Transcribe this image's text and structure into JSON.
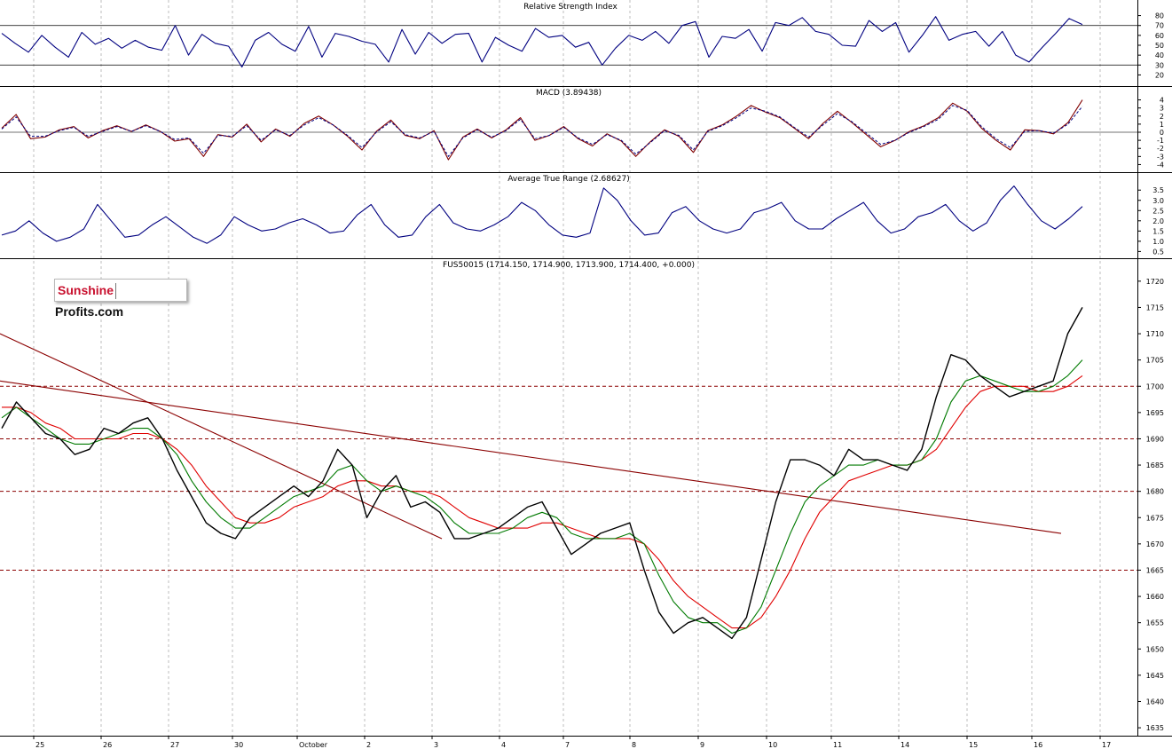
{
  "logo": {
    "part1": "Sunshine",
    "part2": "Profits.com"
  },
  "panels": {
    "rsi": {
      "title": "Relative Strength Index",
      "ticks": [
        "80",
        "70",
        "60",
        "50",
        "40",
        "30",
        "20"
      ],
      "levels": [
        70,
        30
      ]
    },
    "macd": {
      "title": "MACD (3.89438)",
      "ticks": [
        "4",
        "3",
        "2",
        "1",
        "0",
        "-1",
        "-2",
        "-3",
        "-4"
      ]
    },
    "atr": {
      "title": "Average True Range (2.68627)",
      "ticks": [
        "3.5",
        "3.0",
        "2.5",
        "2.0",
        "1.5",
        "1.0",
        "0.5"
      ]
    },
    "price": {
      "title": "FUS50015 (1714.150, 1714.900, 1713.900, 1714.400, +0.000)",
      "ticks": [
        "1720",
        "1715",
        "1710",
        "1705",
        "1700",
        "1695",
        "1690",
        "1685",
        "1680",
        "1675",
        "1670",
        "1665",
        "1660",
        "1655",
        "1650",
        "1645",
        "1640",
        "1635"
      ]
    }
  },
  "x_labels": [
    "25",
    "26",
    "27",
    "30",
    "October",
    "2",
    "3",
    "4",
    "7",
    "8",
    "9",
    "10",
    "11",
    "14",
    "15",
    "16",
    "17"
  ],
  "chart_data": [
    {
      "type": "line",
      "title": "Relative Strength Index",
      "ylim": [
        15,
        85
      ],
      "reference_levels": [
        70,
        30
      ],
      "grid": "on",
      "series": [
        {
          "values": [
            62,
            52,
            43,
            60,
            48,
            38,
            63,
            51,
            57,
            47,
            55,
            48,
            45,
            70,
            40,
            61,
            52,
            49,
            28,
            55,
            63,
            51,
            44,
            69,
            38,
            62,
            59,
            54,
            51,
            33,
            66,
            41,
            63,
            52,
            61,
            62,
            33,
            58,
            50,
            44,
            67,
            58,
            60,
            48,
            53,
            30,
            47,
            60,
            55,
            64,
            52,
            70,
            74,
            38,
            59,
            57,
            66,
            44,
            73,
            70,
            78,
            64,
            61,
            50,
            49,
            75,
            64,
            73,
            43,
            60,
            79,
            55,
            61,
            64,
            49,
            64,
            40,
            33,
            48,
            62,
            77,
            71
          ]
        }
      ]
    },
    {
      "type": "line",
      "title": "MACD (3.89438)",
      "ylim": [
        -4.5,
        4.5
      ],
      "grid": "on",
      "series": [
        {
          "values": [
            0.5,
            2.2,
            -0.8,
            -0.6,
            0.3,
            0.7,
            -0.7,
            0.2,
            0.8,
            0.1,
            0.9,
            0.1,
            -1.1,
            -0.8,
            -3.0,
            -0.3,
            -0.6,
            1.0,
            -1.2,
            0.4,
            -0.5,
            1.1,
            2.0,
            0.9,
            -0.5,
            -2.2,
            0.1,
            1.5,
            -0.4,
            -0.8,
            0.2,
            -3.4,
            -0.6,
            0.4,
            -0.7,
            0.3,
            1.8,
            -1.0,
            -0.4,
            0.7,
            -0.8,
            -1.7,
            -0.2,
            -1.1,
            -3.0,
            -1.2,
            0.3,
            -0.5,
            -2.5,
            0.2,
            0.9,
            2.0,
            3.3,
            2.5,
            1.8,
            0.5,
            -0.8,
            1.1,
            2.6,
            1.2,
            -0.3,
            -1.8,
            -1.0,
            0.1,
            0.8,
            1.8,
            3.6,
            2.6,
            0.5,
            -1.0,
            -2.2,
            0.3,
            0.2,
            -0.2,
            1.2,
            4.0
          ]
        },
        {
          "values": [
            0.4,
            1.9,
            -0.5,
            -0.5,
            0.2,
            0.6,
            -0.5,
            0.1,
            0.7,
            0.1,
            0.8,
            0.1,
            -0.9,
            -0.7,
            -2.6,
            -0.4,
            -0.5,
            0.8,
            -1.0,
            0.3,
            -0.4,
            0.9,
            1.8,
            0.9,
            -0.4,
            -1.9,
            0.0,
            1.3,
            -0.3,
            -0.7,
            0.1,
            -3.0,
            -0.7,
            0.3,
            -0.6,
            0.2,
            1.6,
            -0.8,
            -0.4,
            0.6,
            -0.7,
            -1.5,
            -0.3,
            -1.0,
            -2.7,
            -1.3,
            0.2,
            -0.4,
            -2.2,
            0.1,
            0.8,
            1.8,
            3.0,
            2.6,
            1.9,
            0.6,
            -0.6,
            0.9,
            2.3,
            1.3,
            -0.1,
            -1.5,
            -1.0,
            0.0,
            0.7,
            1.6,
            3.3,
            2.7,
            0.7,
            -0.8,
            -1.9,
            0.1,
            0.2,
            -0.1,
            1.0,
            3.2
          ]
        }
      ]
    },
    {
      "type": "line",
      "title": "Average True Range (2.68627)",
      "ylim": [
        0.3,
        3.9
      ],
      "grid": "on",
      "series": [
        {
          "values": [
            1.3,
            1.5,
            2.0,
            1.4,
            1.0,
            1.2,
            1.6,
            2.8,
            2.0,
            1.2,
            1.3,
            1.8,
            2.2,
            1.7,
            1.2,
            0.9,
            1.3,
            2.2,
            1.8,
            1.5,
            1.6,
            1.9,
            2.1,
            1.8,
            1.4,
            1.5,
            2.3,
            2.8,
            1.8,
            1.2,
            1.3,
            2.2,
            2.8,
            1.9,
            1.6,
            1.5,
            1.8,
            2.2,
            2.9,
            2.5,
            1.8,
            1.3,
            1.2,
            1.4,
            3.6,
            3.0,
            2.0,
            1.3,
            1.4,
            2.4,
            2.7,
            2.0,
            1.6,
            1.4,
            1.6,
            2.4,
            2.6,
            2.9,
            2.0,
            1.6,
            1.6,
            2.1,
            2.5,
            2.9,
            2.0,
            1.4,
            1.6,
            2.2,
            2.4,
            2.8,
            2.0,
            1.5,
            1.9,
            3.0,
            3.7,
            2.8,
            2.0,
            1.6,
            2.1,
            2.7
          ]
        }
      ]
    },
    {
      "type": "line",
      "title": "FUS50015 (1714.150, 1714.900, 1713.900, 1714.400, +0.000)",
      "ylim": [
        1634,
        1722
      ],
      "grid": "on",
      "horizontal_levels": [
        1700,
        1690,
        1680,
        1665
      ],
      "trendlines": [
        {
          "from": [
            "25",
            1710
          ],
          "to": [
            "3",
            1671
          ]
        },
        {
          "from": [
            "25",
            1701
          ],
          "to": [
            "16",
            1672
          ]
        }
      ],
      "series": [
        {
          "values": [
            1692,
            1697,
            1694,
            1691,
            1690,
            1687,
            1688,
            1692,
            1691,
            1693,
            1694,
            1690,
            1684,
            1679,
            1674,
            1672,
            1671,
            1675,
            1677,
            1679,
            1681,
            1679,
            1682,
            1688,
            1685,
            1675,
            1680,
            1683,
            1677,
            1678,
            1676,
            1671,
            1671,
            1672,
            1673,
            1675,
            1677,
            1678,
            1673,
            1668,
            1670,
            1672,
            1673,
            1674,
            1665,
            1657,
            1653,
            1655,
            1656,
            1654,
            1652,
            1656,
            1667,
            1678,
            1686,
            1686,
            1685,
            1683,
            1688,
            1686,
            1686,
            1685,
            1684,
            1688,
            1698,
            1706,
            1705,
            1702,
            1700,
            1698,
            1699,
            1700,
            1701,
            1710,
            1715
          ]
        },
        {
          "values": [
            1694,
            1696,
            1694,
            1692,
            1690,
            1689,
            1689,
            1690,
            1691,
            1692,
            1692,
            1690,
            1687,
            1682,
            1678,
            1675,
            1673,
            1673,
            1675,
            1677,
            1679,
            1680,
            1681,
            1684,
            1685,
            1682,
            1680,
            1681,
            1680,
            1679,
            1677,
            1674,
            1672,
            1672,
            1672,
            1673,
            1675,
            1676,
            1675,
            1672,
            1671,
            1671,
            1671,
            1672,
            1670,
            1664,
            1659,
            1656,
            1655,
            1655,
            1653,
            1654,
            1658,
            1665,
            1672,
            1678,
            1681,
            1683,
            1685,
            1685,
            1686,
            1685,
            1685,
            1686,
            1690,
            1697,
            1701,
            1702,
            1701,
            1700,
            1699,
            1699,
            1700,
            1702,
            1705
          ]
        },
        {
          "values": [
            1696,
            1696,
            1695,
            1693,
            1692,
            1690,
            1690,
            1690,
            1690,
            1691,
            1691,
            1690,
            1688,
            1685,
            1681,
            1678,
            1675,
            1674,
            1674,
            1675,
            1677,
            1678,
            1679,
            1681,
            1682,
            1682,
            1681,
            1681,
            1680,
            1680,
            1679,
            1677,
            1675,
            1674,
            1673,
            1673,
            1673,
            1674,
            1674,
            1673,
            1672,
            1671,
            1671,
            1671,
            1670,
            1667,
            1663,
            1660,
            1658,
            1656,
            1654,
            1654,
            1656,
            1660,
            1665,
            1671,
            1676,
            1679,
            1682,
            1683,
            1684,
            1685,
            1685,
            1686,
            1688,
            1692,
            1696,
            1699,
            1700,
            1700,
            1700,
            1699,
            1699,
            1700,
            1702
          ]
        }
      ]
    }
  ]
}
